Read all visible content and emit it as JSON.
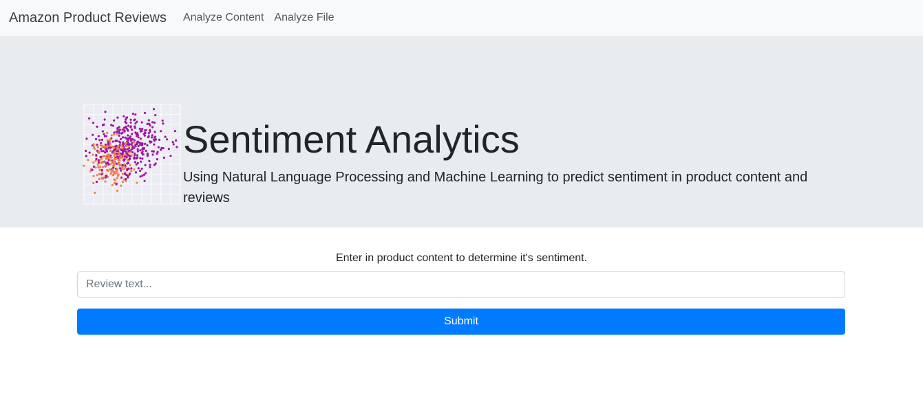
{
  "navbar": {
    "brand": "Amazon Product Reviews",
    "links": [
      "Analyze Content",
      "Analyze File"
    ]
  },
  "hero": {
    "title": "Sentiment Analytics",
    "lead": "Using Natural Language Processing and Machine Learning to predict sentiment in product content and reviews",
    "logo_colors": {
      "positive": "#9c179e",
      "negative": "#f0804c"
    }
  },
  "form": {
    "prompt": "Enter in product content to determine it's sentiment.",
    "input_placeholder": "Review text...",
    "input_value": "",
    "submit_label": "Submit"
  },
  "colors": {
    "primary": "#007bff",
    "navbar_bg": "#f8f9fa",
    "jumbotron_bg": "#e9ecef"
  }
}
